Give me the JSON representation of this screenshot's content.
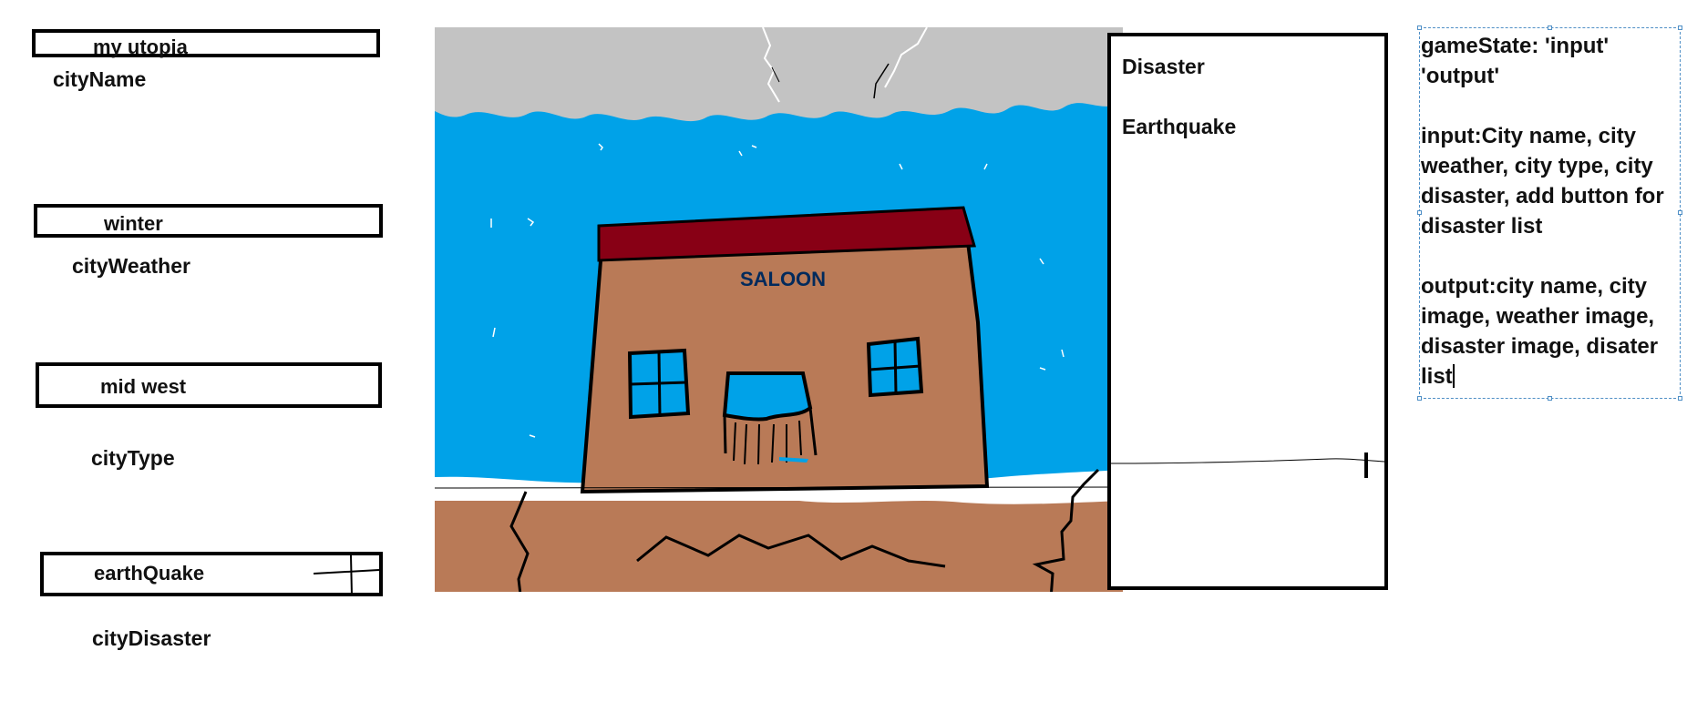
{
  "inputs": {
    "city_name": {
      "value": "my utopia",
      "label": "cityName"
    },
    "city_weather": {
      "value": "winter",
      "label": "cityWeather"
    },
    "city_type": {
      "value": "mid west",
      "label": "cityType"
    },
    "city_disaster": {
      "value": "earthQuake",
      "label": "cityDisaster"
    }
  },
  "scene": {
    "sign_text": "SALOON",
    "colors": {
      "sky": "#00a2e8",
      "cloud": "#c3c3c3",
      "ground": "#b97a57",
      "roof": "#880015",
      "building": "#b97a57",
      "window": "#00a2e8",
      "snow": "#ffffff",
      "outline": "#000000"
    }
  },
  "disaster_list": {
    "title": "Disaster",
    "items": [
      "Earthquake"
    ]
  },
  "notes": {
    "line1": "gameState: 'input' 'output'",
    "line2": "input:City name, city weather, city type, city disaster, add button for disaster list",
    "line3": "output:city name, city image, weather image, disaster image, disater list"
  },
  "icons": {
    "add_button": "plus-icon",
    "text_cursor": "i-beam-cursor-icon"
  }
}
